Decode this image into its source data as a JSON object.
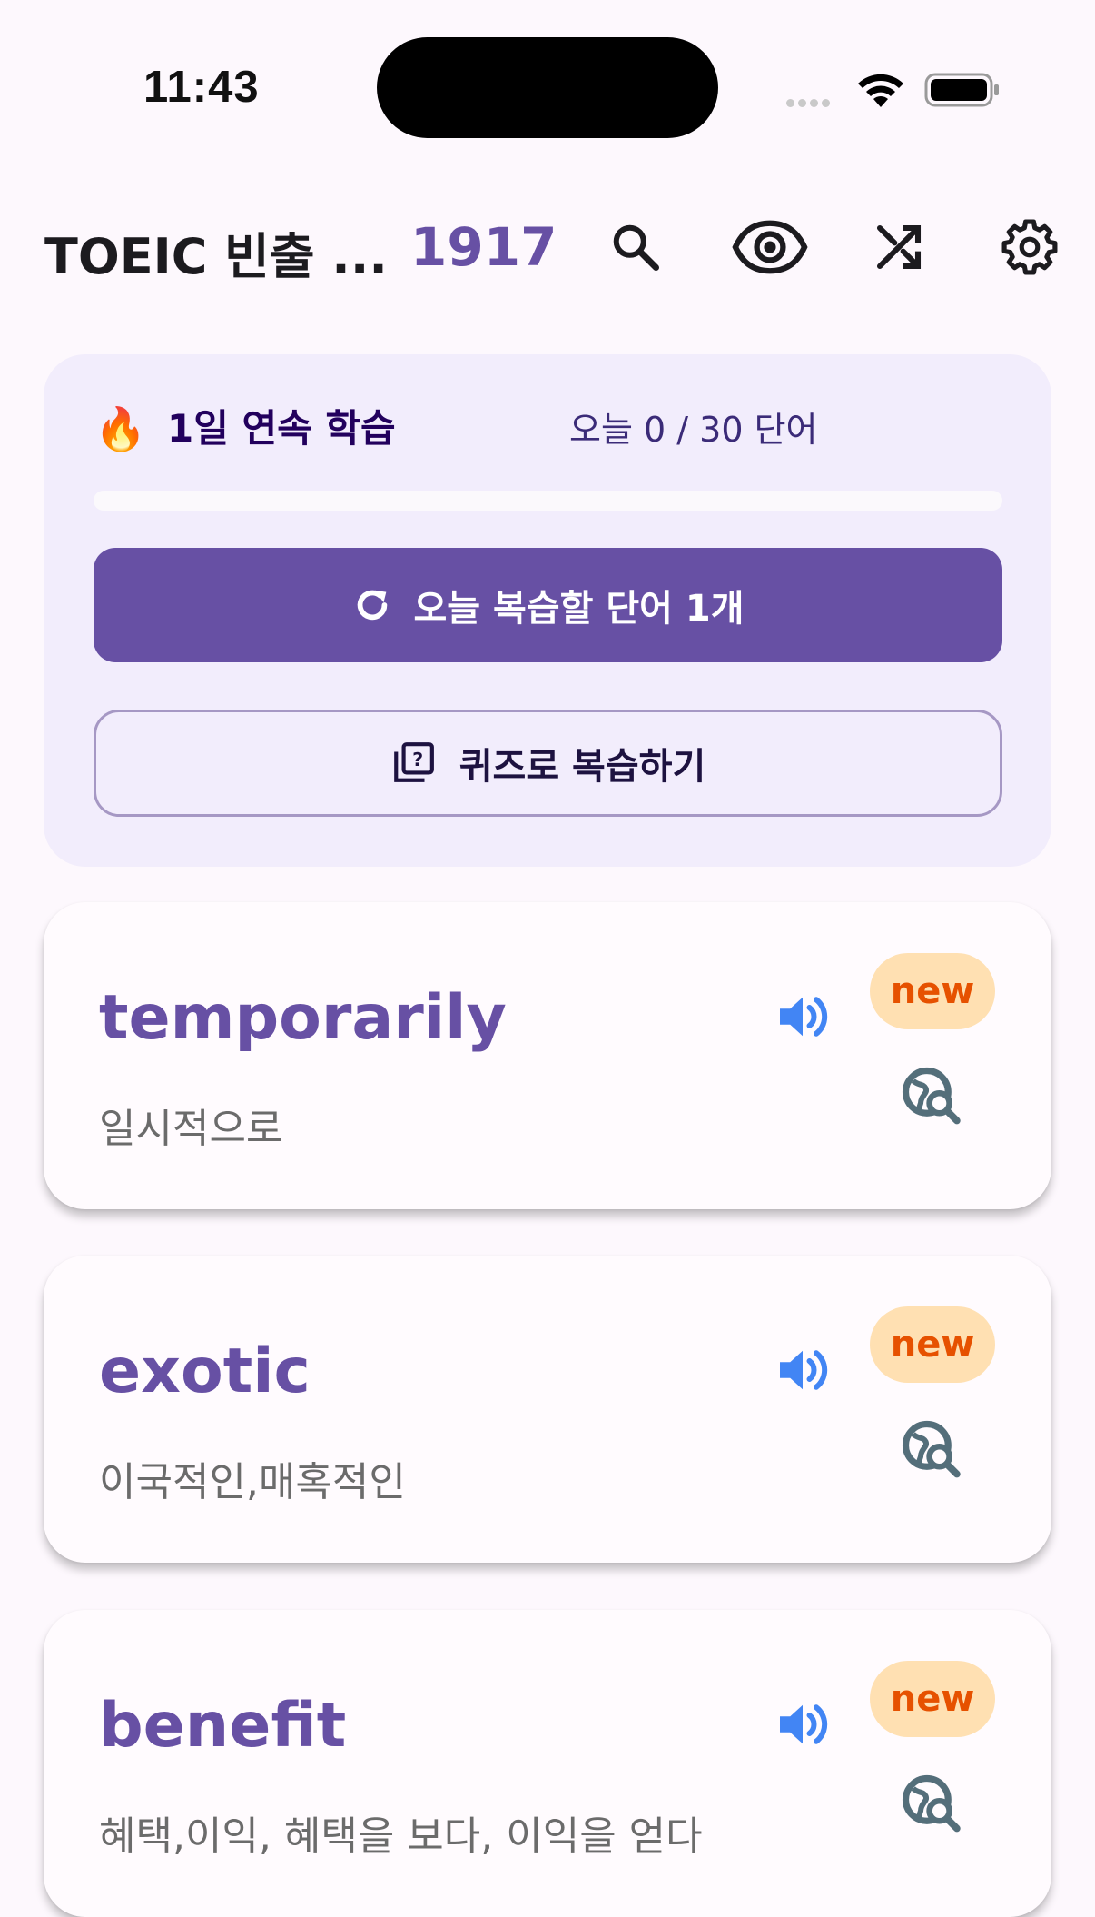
{
  "status_bar": {
    "time": "11:43"
  },
  "app_bar": {
    "title": "TOEIC 빈출 ...",
    "word_count": "1917",
    "icons": [
      "search-icon",
      "eye-icon",
      "shuffle-icon",
      "settings-icon"
    ]
  },
  "study": {
    "streak_icon": "🔥",
    "streak_label": "1일 연속 학습",
    "today_progress": "오늘 0 / 30 단어",
    "progress_fraction": 0,
    "review_button_label": "오늘 복습할 단어 1개",
    "quiz_button_label": "퀴즈로 복습하기"
  },
  "words": [
    {
      "term": "temporarily",
      "meaning": "일시적으로",
      "badge": "new"
    },
    {
      "term": "exotic",
      "meaning": "이국적인,매혹적인",
      "badge": "new"
    },
    {
      "term": "benefit",
      "meaning": "혜택,이익, 혜택을 보다, 이익을 얻다",
      "badge": "new"
    }
  ],
  "colors": {
    "primary": "#6750a4",
    "card_tint": "#f2edfc",
    "badge_bg": "#ffe0b2",
    "badge_text": "#e65100",
    "speaker": "#4285f4",
    "lookup": "#546e7a"
  }
}
